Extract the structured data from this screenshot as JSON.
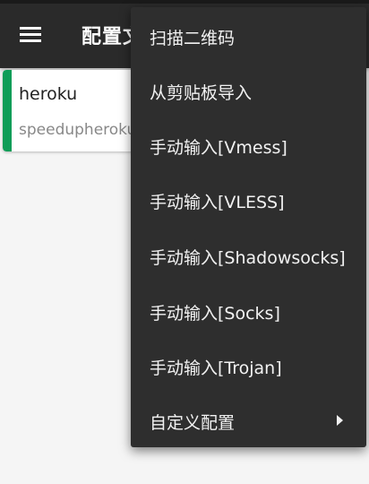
{
  "toolbar": {
    "title": "配置文件",
    "menu_icon": "hamburger-menu-icon"
  },
  "server_list": [
    {
      "name": "heroku",
      "address": "speedupheroku",
      "accent_color": "#0f9d58"
    }
  ],
  "overflow_menu": {
    "items": [
      {
        "label": "扫描二维码"
      },
      {
        "label": "从剪贴板导入"
      },
      {
        "label": "手动输入[Vmess]"
      },
      {
        "label": "手动输入[VLESS]"
      },
      {
        "label": "手动输入[Shadowsocks]"
      },
      {
        "label": "手动输入[Socks]"
      },
      {
        "label": "手动输入[Trojan]"
      },
      {
        "label": "自定义配置",
        "submenu_icon": "chevron-right-icon"
      }
    ]
  },
  "colors": {
    "toolbar_bg": "#2a2a2a",
    "menu_bg": "#2e2e2e",
    "page_bg": "#f5f5f5",
    "accent": "#0f9d58"
  }
}
